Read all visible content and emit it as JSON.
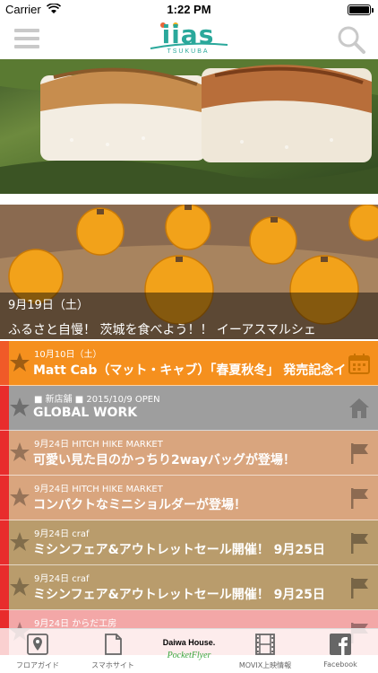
{
  "status": {
    "carrier": "Carrier",
    "time": "1:22 PM",
    "battery_level": 1.0
  },
  "nav": {
    "logo_text": "iias",
    "logo_sub": "TSUKUBA",
    "menu_icon": "hamburger-icon",
    "search_icon": "search-icon"
  },
  "hero": {
    "date": "9月19日（土）",
    "title": "ふるさと自慢！ 茨城を食べよう！！ イーアスマルシェ"
  },
  "list": [
    {
      "meta": "10月10日（土）",
      "title": "Matt Cab（マット・キャブ）「春夏秋冬」 発売記念イ",
      "icon": "calendar-icon",
      "bg": "#f5901e",
      "stripe": "#f05a28"
    },
    {
      "meta": "■ 新店舗 ■ 2015/10/9 OPEN",
      "title": "GLOBAL WORK",
      "icon": "home-icon",
      "bg": "#9e9e9e",
      "stripe": "#e82c2c"
    },
    {
      "meta": "9月24日 HITCH HIKE MARKET",
      "title": "可愛い見た目のかっちり2wayバッグが登場！",
      "icon": "flag-icon",
      "bg": "#d9a57e",
      "stripe": "#e82c2c"
    },
    {
      "meta": "9月24日 HITCH HIKE MARKET",
      "title": "コンパクトなミニショルダーが登場！",
      "icon": "flag-icon",
      "bg": "#d9a57e",
      "stripe": "#e82c2c"
    },
    {
      "meta": "9月24日 craf",
      "title": "ミシンフェア&アウトレットセール開催！ 9月25日",
      "icon": "flag-icon",
      "bg": "#b99c6c",
      "stripe": "#e82c2c"
    },
    {
      "meta": "9月24日 craf",
      "title": "ミシンフェア&アウトレットセール開催！ 9月25日",
      "icon": "flag-icon",
      "bg": "#b99c6c",
      "stripe": "#e82c2c"
    },
    {
      "meta": "9月24日 からだ工房",
      "title": "",
      "icon": "flag-icon",
      "bg": "#f3a7a7",
      "stripe": "#e82c2c"
    }
  ],
  "tabs": [
    {
      "label": "フロアガイド",
      "icon": "map-pin-icon"
    },
    {
      "label": "スマホサイト",
      "icon": "document-icon"
    },
    {
      "brand_top": "Daiwa House.",
      "brand_bottom": "PocketFlyer",
      "label": ""
    },
    {
      "label": "MOVIX上映情報",
      "icon": "film-icon"
    },
    {
      "label": "Facebook",
      "icon": "facebook-icon"
    }
  ]
}
